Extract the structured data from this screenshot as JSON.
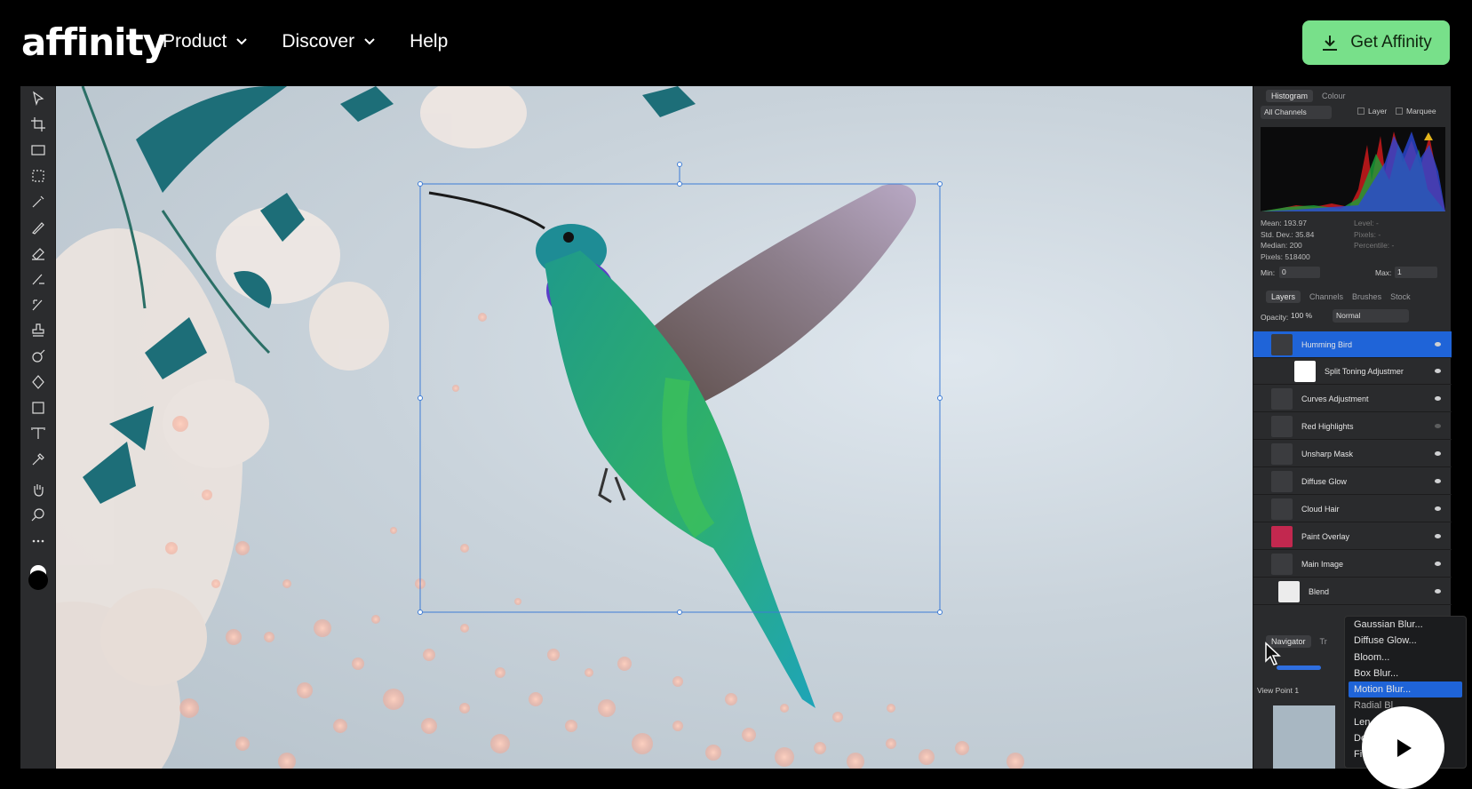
{
  "nav": {
    "logo": "affinity",
    "product": "Product",
    "discover": "Discover",
    "help": "Help",
    "cta": "Get Affinity"
  },
  "histogram": {
    "tab_histogram": "Histogram",
    "tab_colour": "Colour",
    "channels": "All Channels",
    "layer_label": "Layer",
    "marquee_label": "Marquee",
    "mean": "Mean: 193.97",
    "stddev": "Std. Dev.: 35.84",
    "median": "Median: 200",
    "pixels": "Pixels: 518400",
    "level": "Level: -",
    "pixels_r": "Pixels: -",
    "percentile": "Percentile: -",
    "min_label": "Min:",
    "min_val": "0",
    "max_label": "Max:",
    "max_val": "1"
  },
  "layers_panel": {
    "tab_layers": "Layers",
    "tab_channels": "Channels",
    "tab_brushes": "Brushes",
    "tab_stock": "Stock",
    "opacity_label": "Opacity:",
    "opacity_val": "100 %",
    "blend_mode": "Normal",
    "layers": [
      {
        "name": "Humming Bird"
      },
      {
        "name": "Split Toning Adjustmer"
      },
      {
        "name": "Curves Adjustment"
      },
      {
        "name": "Red Highlights"
      },
      {
        "name": "Unsharp Mask"
      },
      {
        "name": "Diffuse Glow"
      },
      {
        "name": "Cloud Hair"
      },
      {
        "name": "Paint Overlay"
      },
      {
        "name": "Main Image"
      },
      {
        "name": "Blend"
      }
    ]
  },
  "navigator": {
    "tab": "Navigator",
    "tab2": "Tr",
    "viewpoint": "View Point 1"
  },
  "blur_menu": {
    "items": [
      "Gaussian Blur...",
      "Diffuse Glow...",
      "Bloom...",
      "Box Blur...",
      "Motion Blur...",
      "Radial Bl",
      "Len",
      "De",
      "Fi"
    ]
  },
  "colors": {
    "cta_bg": "#78e08a",
    "selection": "#1f64d8",
    "panel_bg": "#2a2b2d"
  }
}
